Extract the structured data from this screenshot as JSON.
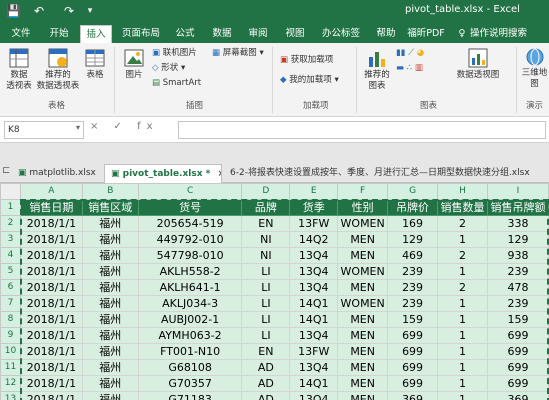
{
  "titlebar": {
    "title": "pivot_table.xlsx  -  Excel",
    "save_icon": "💾",
    "undo_icon": "↶",
    "redo_icon": "↷",
    "customize_icon": "▾"
  },
  "ribbon_tabs": [
    "文件",
    "开始",
    "插入",
    "页面布局",
    "公式",
    "数据",
    "审阅",
    "视图",
    "办公标签",
    "帮助",
    "福昕PDF",
    "操作说明搜索"
  ],
  "ribbon": {
    "tables": {
      "pivot": "数据\n透视表",
      "recommended": "推荐的\n数据透视表",
      "table": "表格",
      "group": "表格"
    },
    "illustrations": {
      "picture": "图片",
      "online_picture": "联机图片",
      "shapes": "形状",
      "smartart": "SmartArt",
      "screenshot": "屏幕截图",
      "group": "插图"
    },
    "addins": {
      "get": "获取加载项",
      "my": "我的加载项",
      "group": "加载项"
    },
    "charts": {
      "recommended": "推荐的\n图表",
      "pivotchart": "数据透视图",
      "group": "图表"
    },
    "tours": {
      "map": "三维地\n图",
      "group": "演示"
    }
  },
  "formula_bar": {
    "namebox": "K8",
    "fx_label": "× ✓ fx",
    "value": ""
  },
  "workbook_tabs": [
    {
      "label": "matplotlib.xlsx",
      "active": false
    },
    {
      "label": "pivot_table.xlsx *",
      "active": true
    },
    {
      "label": "6-2-将报表快速设置成按年、季度、月进行汇总—日期型数据快速分组.xlsx",
      "active": false
    }
  ],
  "sheet": {
    "column_letters": [
      "A",
      "B",
      "C",
      "D",
      "E",
      "F",
      "G",
      "H",
      "I"
    ],
    "headers": [
      "销售日期",
      "销售区域",
      "货号",
      "品牌",
      "货季",
      "性别",
      "吊牌价",
      "销售数量",
      "销售吊牌额"
    ],
    "rows": [
      [
        "2018/1/1",
        "福州",
        "205654-519",
        "EN",
        "13FW",
        "WOMEN",
        "169",
        "2",
        "338"
      ],
      [
        "2018/1/1",
        "福州",
        "449792-010",
        "NI",
        "14Q2",
        "MEN",
        "129",
        "1",
        "129"
      ],
      [
        "2018/1/1",
        "福州",
        "547798-010",
        "NI",
        "13Q4",
        "MEN",
        "469",
        "2",
        "938"
      ],
      [
        "2018/1/1",
        "福州",
        "AKLH558-2",
        "LI",
        "13Q4",
        "WOMEN",
        "239",
        "1",
        "239"
      ],
      [
        "2018/1/1",
        "福州",
        "AKLH641-1",
        "LI",
        "13Q4",
        "MEN",
        "239",
        "2",
        "478"
      ],
      [
        "2018/1/1",
        "福州",
        "AKLJ034-3",
        "LI",
        "14Q1",
        "WOMEN",
        "239",
        "1",
        "239"
      ],
      [
        "2018/1/1",
        "福州",
        "AUBJ002-1",
        "LI",
        "14Q1",
        "MEN",
        "159",
        "1",
        "159"
      ],
      [
        "2018/1/1",
        "福州",
        "AYMH063-2",
        "LI",
        "13Q4",
        "MEN",
        "699",
        "1",
        "699"
      ],
      [
        "2018/1/1",
        "福州",
        "FT001-N10",
        "EN",
        "13FW",
        "MEN",
        "699",
        "1",
        "699"
      ],
      [
        "2018/1/1",
        "福州",
        "G68108",
        "AD",
        "13Q4",
        "MEN",
        "699",
        "1",
        "699"
      ],
      [
        "2018/1/1",
        "福州",
        "G70357",
        "AD",
        "14Q1",
        "MEN",
        "699",
        "1",
        "699"
      ],
      [
        "2018/1/1",
        "福州",
        "G71183",
        "AD",
        "13Q4",
        "MEN",
        "369",
        "1",
        "369"
      ]
    ],
    "row_numbers": [
      "1",
      "2",
      "3",
      "4",
      "5",
      "6",
      "7",
      "8",
      "9",
      "10",
      "11",
      "12",
      "13"
    ]
  },
  "colors": {
    "accent": "#217346",
    "selection": "#d8efe0"
  }
}
